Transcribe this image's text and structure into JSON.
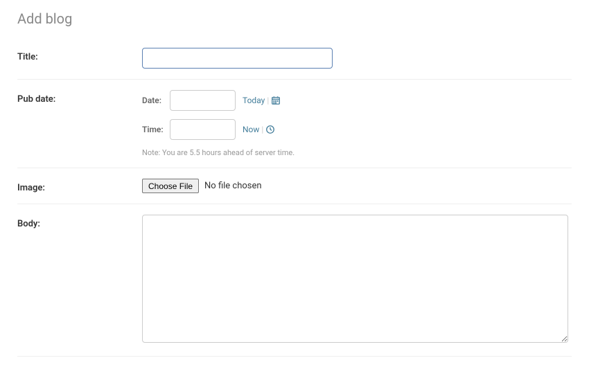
{
  "page": {
    "title": "Add blog"
  },
  "form": {
    "title": {
      "label": "Title:",
      "value": ""
    },
    "pub_date": {
      "label": "Pub date:",
      "date": {
        "sub_label": "Date:",
        "value": "",
        "today_link": "Today"
      },
      "time": {
        "sub_label": "Time:",
        "value": "",
        "now_link": "Now"
      },
      "help": "Note: You are 5.5 hours ahead of server time."
    },
    "image": {
      "label": "Image:",
      "button": "Choose File",
      "status": "No file chosen"
    },
    "body": {
      "label": "Body:",
      "value": ""
    }
  }
}
